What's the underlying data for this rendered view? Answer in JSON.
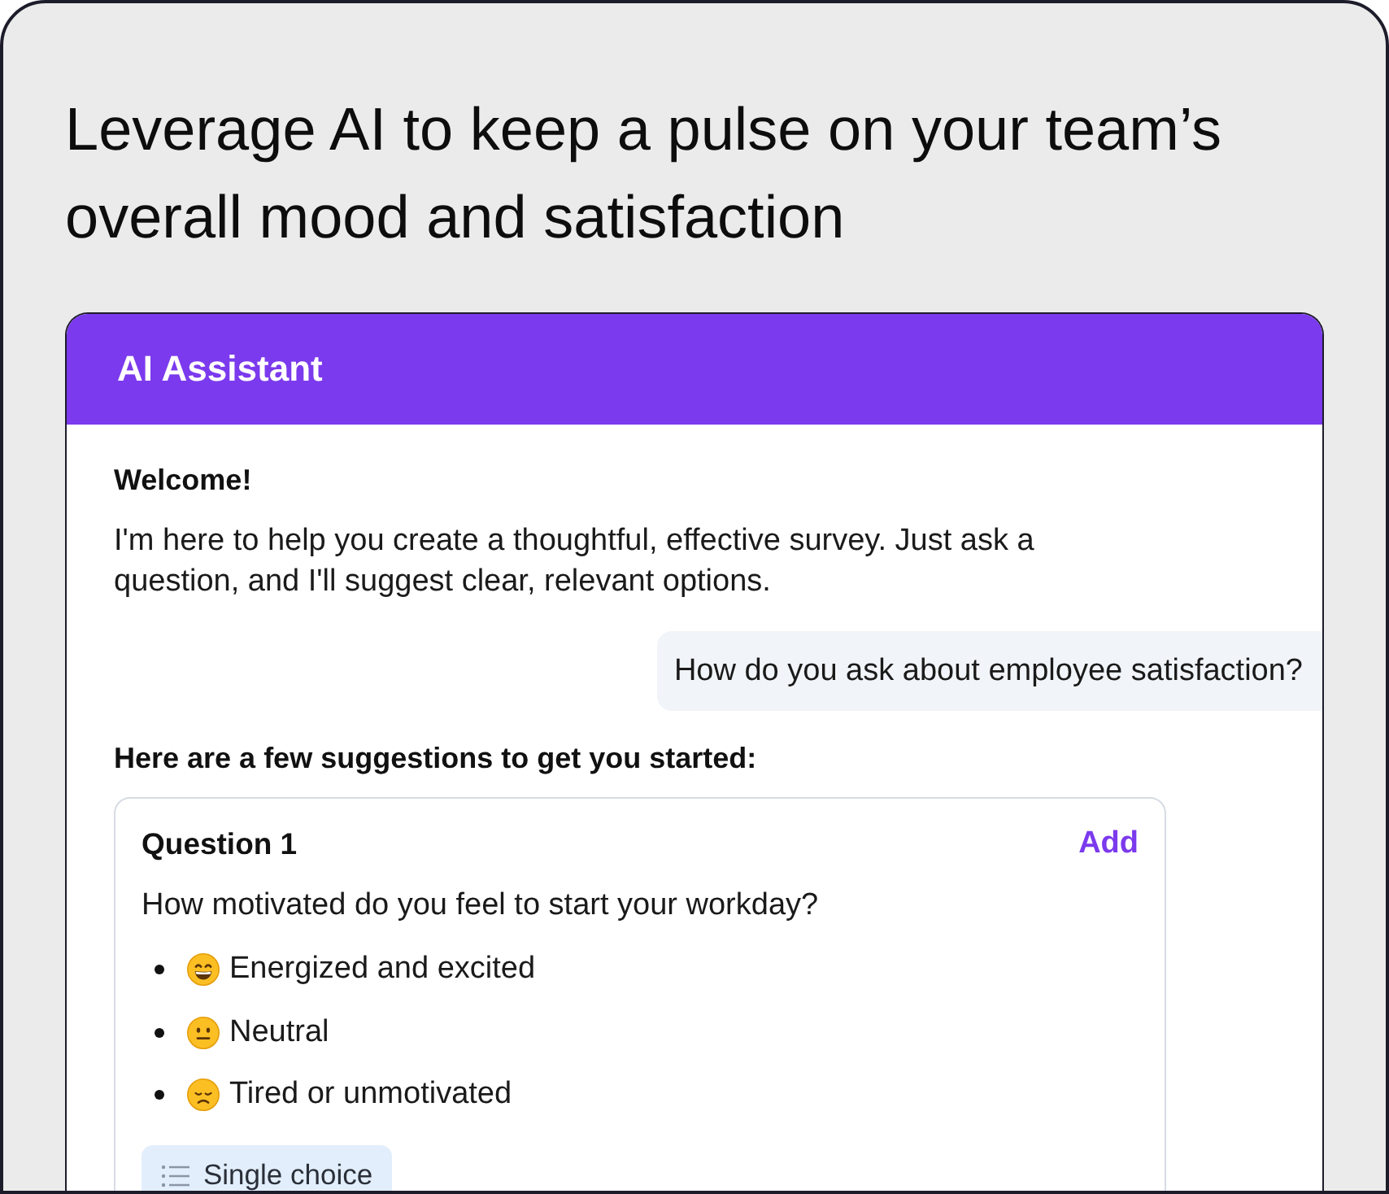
{
  "heading": "Leverage AI to keep a pulse on your team’s overall mood and satisfaction",
  "assistant": {
    "title": "AI Assistant",
    "welcome": {
      "title": "Welcome!",
      "text": "I'm here to help you create a thoughtful, effective survey. Just ask a question, and I'll suggest clear, relevant options."
    },
    "user_message": "How do you ask about employee satisfaction?",
    "suggestions_intro": "Here are a few suggestions to get you started:",
    "questions": [
      {
        "label": "Question 1",
        "action": "Add",
        "text": "How motivated do you feel to start your workday?",
        "options": [
          {
            "kind": "positive",
            "label": "Energized and excited"
          },
          {
            "kind": "neutral",
            "label": "Neutral"
          },
          {
            "kind": "negative",
            "label": "Tired or unmotivated"
          }
        ],
        "type": "Single choice"
      }
    ]
  }
}
